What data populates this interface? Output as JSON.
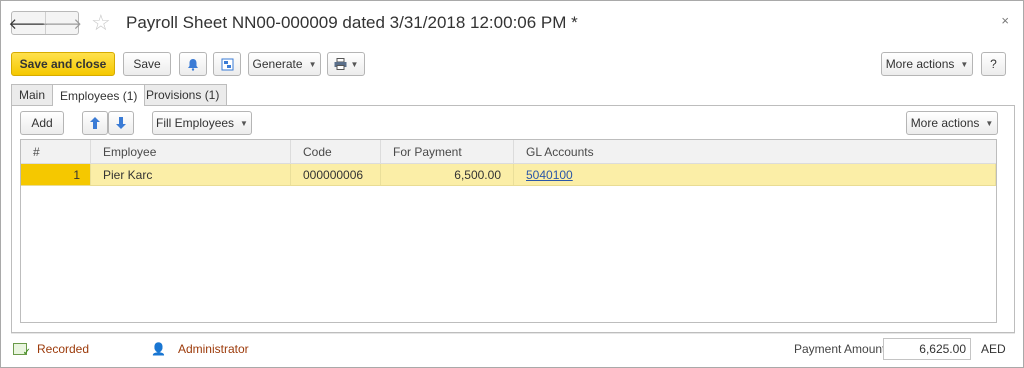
{
  "header": {
    "title": "Payroll Sheet NN00-000009 dated 3/31/2018 12:00:06 PM *",
    "back_glyph": "🡐",
    "forward_glyph": "🡒",
    "star_glyph": "☆",
    "close_glyph": "×"
  },
  "toolbar": {
    "save_and_close": "Save and close",
    "save": "Save",
    "generate": "Generate",
    "more_actions": "More actions",
    "help": "?"
  },
  "tabs": [
    {
      "label": "Main"
    },
    {
      "label": "Employees (1)"
    },
    {
      "label": "Provisions (1)"
    }
  ],
  "panel_toolbar": {
    "add": "Add",
    "fill_employees": "Fill Employees",
    "more_actions": "More actions"
  },
  "table": {
    "columns": [
      "#",
      "Employee",
      "Code",
      "For Payment",
      "GL Accounts"
    ],
    "rows": [
      {
        "num": "1",
        "employee": "Pier Karc",
        "code": "000000006",
        "for_payment": "6,500.00",
        "gl_account": "5040100"
      }
    ]
  },
  "footer": {
    "status": "Recorded",
    "user": "Administrator",
    "payment_label": "Payment Amount:",
    "payment_amount": "6,625.00",
    "currency": "AED"
  },
  "colors": {
    "primary_button": "#f5c800",
    "selected_row": "#fbeea7",
    "status_text": "#9c3a0a",
    "link": "#2b57a8"
  }
}
